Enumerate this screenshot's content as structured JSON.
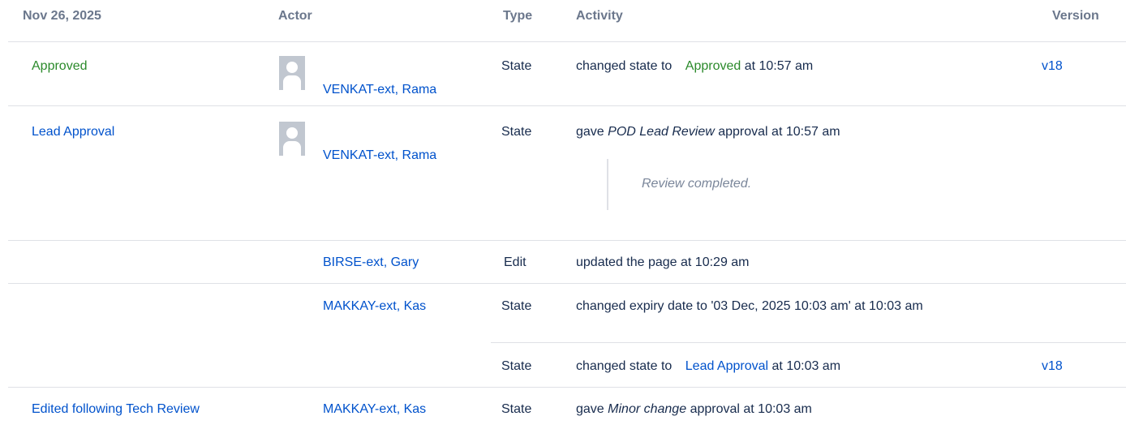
{
  "header": {
    "date": "Nov 26, 2025",
    "actor": "Actor",
    "type": "Type",
    "activity": "Activity",
    "version": "Version"
  },
  "rows": [
    {
      "label": "Approved",
      "actor": "VENKAT-ext, Rama",
      "type": "State",
      "activity_prefix": "changed state to",
      "activity_state": "Approved",
      "activity_suffix": "at 10:57 am",
      "version": "v18"
    },
    {
      "label": "Lead Approval",
      "actor": "VENKAT-ext, Rama",
      "type": "State",
      "activity_prefix": "gave",
      "activity_italic": "POD Lead Review",
      "activity_suffix": "approval at 10:57 am",
      "comment": "Review completed."
    },
    {
      "actor": "BIRSE-ext, Gary",
      "type": "Edit",
      "activity": "updated the page at 10:29 am"
    },
    {
      "actor": "MAKKAY-ext, Kas",
      "type": "State",
      "activity": "changed expiry date to '03 Dec, 2025 10:03 am' at 10:03 am"
    },
    {
      "type": "State",
      "activity_prefix": "changed state to",
      "activity_state": "Lead Approval",
      "activity_suffix": "at 10:03 am",
      "version": "v18"
    },
    {
      "label": "Edited following Tech Review",
      "actor": "MAKKAY-ext, Kas",
      "type": "State",
      "activity_prefix": "gave",
      "activity_italic": "Minor change",
      "activity_suffix": "approval at 10:03 am"
    }
  ]
}
